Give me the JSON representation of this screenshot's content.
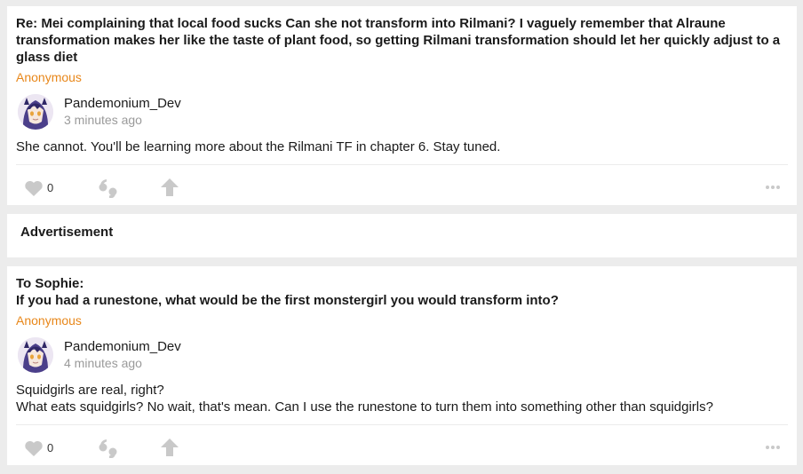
{
  "posts": [
    {
      "question": "Re: Mei complaining that local food sucks Can she not transform into Rilmani? I vaguely remember that Alraune transformation makes her like the taste of plant food, so getting Rilmani transformation should let her quickly adjust to a glass diet",
      "asker": "Anonymous",
      "author": "Pandemonium_Dev",
      "time": "3 minutes ago",
      "answer_lines": [
        "She cannot. You'll be learning more about the Rilmani TF in chapter 6. Stay tuned."
      ],
      "like_count": "0"
    },
    {
      "question_lines": [
        "To Sophie:",
        "If you had a runestone, what would be the first monstergirl you would transform into?"
      ],
      "asker": "Anonymous",
      "author": "Pandemonium_Dev",
      "time": "4 minutes ago",
      "answer_lines": [
        "Squidgirls are real, right?",
        "What eats squidgirls? No wait, that's mean. Can I use the runestone to turn them into something other than squidgirls?"
      ],
      "like_count": "0"
    }
  ],
  "advertisement": {
    "label": "Advertisement"
  },
  "colors": {
    "accent": "#e8871a",
    "icon": "#c9c9c9",
    "muted": "#9a9a9a",
    "background": "#ececec"
  },
  "icons": [
    "heart-icon",
    "quote-icon",
    "share-arrow-icon",
    "more-dots-icon"
  ]
}
